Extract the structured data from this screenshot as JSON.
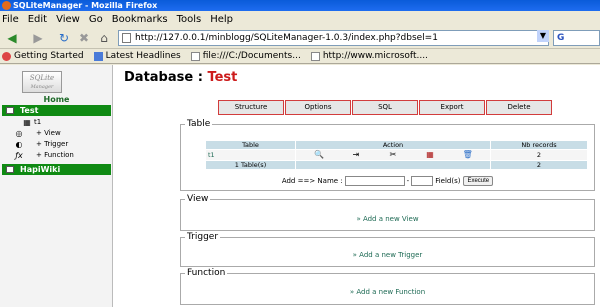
{
  "window": {
    "title": "SQLiteManager - Mozilla Firefox"
  },
  "menu": [
    "File",
    "Edit",
    "View",
    "Go",
    "Bookmarks",
    "Tools",
    "Help"
  ],
  "nav": {
    "url": "http://127.0.0.1/minblogg/SQLiteManager-1.0.3/index.php?dbsel=1",
    "search_value": "G"
  },
  "bookmarks": [
    "Getting Started",
    "Latest Headlines",
    "file:///C:/Documents...",
    "http://www.microsoft...."
  ],
  "sidebar": {
    "logo_top": "SQLite",
    "logo_bottom": "Manager",
    "home": "Home",
    "databases": [
      {
        "name": "Test"
      },
      {
        "name": "HapiWiki"
      }
    ],
    "tree": [
      {
        "label": "t1",
        "icon": "table-icon"
      },
      {
        "label": "+ View",
        "icon": "view-icon"
      },
      {
        "label": "+ Trigger",
        "icon": "trigger-icon"
      },
      {
        "label": "+ Function",
        "icon": "function-icon"
      }
    ]
  },
  "page": {
    "title_prefix": "Database : ",
    "db_name": "Test"
  },
  "tabs": [
    "Structure",
    "Options",
    "SQL",
    "Export",
    "Delete"
  ],
  "table_section": {
    "legend": "Table",
    "headers": [
      "Table",
      "Action",
      "Nb records"
    ],
    "rows": [
      {
        "name": "t1",
        "records": "2"
      }
    ],
    "summary": {
      "label": "1 Table(s)",
      "records": "2"
    },
    "add_label": "Add ==> Name :",
    "dash": "-",
    "fields_label": "Field(s)",
    "execute": "Execute"
  },
  "view_section": {
    "legend": "View",
    "link": "» Add a new View"
  },
  "trigger_section": {
    "legend": "Trigger",
    "link": "» Add a new Trigger"
  },
  "function_section": {
    "legend": "Function",
    "link": "» Add a new Function"
  }
}
